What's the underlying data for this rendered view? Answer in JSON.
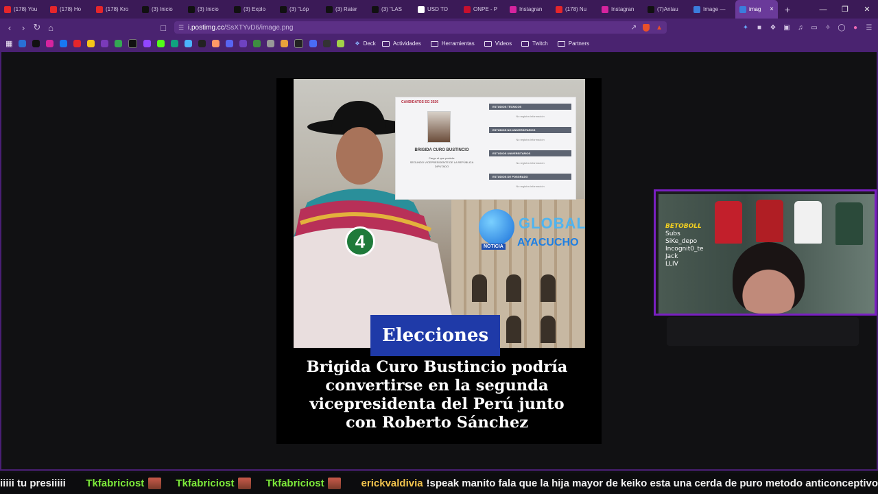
{
  "tabs": [
    {
      "label": "(178) You",
      "icon": "youtube-icon",
      "color": "#e5262b"
    },
    {
      "label": "(178) Ho",
      "icon": "youtube-icon",
      "color": "#e5262b"
    },
    {
      "label": "(178) Kro",
      "icon": "youtube-icon",
      "color": "#e5262b"
    },
    {
      "label": "(3) Inicio",
      "icon": "x-icon",
      "color": "#111111"
    },
    {
      "label": "(3) Inicio",
      "icon": "x-icon",
      "color": "#111111"
    },
    {
      "label": "(3) Explo",
      "icon": "x-icon",
      "color": "#111111"
    },
    {
      "label": "(3) \"Lóp",
      "icon": "x-icon",
      "color": "#111111"
    },
    {
      "label": "(3) Rater",
      "icon": "x-icon",
      "color": "#111111"
    },
    {
      "label": "(3) \"LAS",
      "icon": "x-icon",
      "color": "#111111"
    },
    {
      "label": "USD TO",
      "icon": "google-icon",
      "color": "#ffffff"
    },
    {
      "label": "ONPE - P",
      "icon": "onpe-icon",
      "color": "#c8102e"
    },
    {
      "label": "Instagran",
      "icon": "instagram-icon",
      "color": "#d6249f"
    },
    {
      "label": "(178) Nu",
      "icon": "youtube-icon",
      "color": "#e5262b"
    },
    {
      "label": "Instagran",
      "icon": "instagram-icon",
      "color": "#d6249f"
    },
    {
      "label": "(7)Antau",
      "icon": "tiktok-icon",
      "color": "#111111"
    },
    {
      "label": "Image —",
      "icon": "postimages-icon",
      "color": "#3b7ddd"
    },
    {
      "label": "imag",
      "icon": "postimages-icon",
      "color": "#3b7ddd",
      "active": true
    }
  ],
  "url": {
    "host": "i.postimg.cc",
    "path": "/SsXTYvD6/image.png"
  },
  "bookmarks": {
    "deck": "Deck",
    "folders": [
      "Actividades",
      "Herramientas",
      "Videos",
      "Twitch",
      "Partners"
    ]
  },
  "card": {
    "back": "CANDIDATOS EG 2026",
    "name": "BRIGIDA CURO BUSTINCIO",
    "cargo_label": "Cargo al que postula:",
    "cargo": "SEGUNDO VICEPRESIDENTE DE LA REPÚBLICA",
    "cargo2": "DIPUTADO",
    "sections": [
      "ESTUDIOS TÉCNICOS",
      "ESTUDIOS NO UNIVERSITARIOS",
      "ESTUDIOS UNIVERSITARIOS",
      "ESTUDIOS DE POSGRADO"
    ],
    "no_records": "No registra información"
  },
  "logo": {
    "global": "GLOBAL",
    "ayacucho": "AYACUCHO",
    "noticia": "NOTICIA"
  },
  "badge_number": "4",
  "section_tag": "Elecciones",
  "headline": "Brigida Curo Bustincio podría convertirse en la segunda vicepresidenta del Perú junto con Roberto Sánchez",
  "webcam": {
    "brand": "BETOBOLL",
    "lines": [
      "Subs",
      "SiKe_depo",
      "Incognit0_te",
      "Jack",
      "LLIV"
    ]
  },
  "ticker": {
    "partial": "iiiii tu presiiiii",
    "user1": "Tkfabriciost",
    "user2": "Tkfabriciost",
    "user3": "Tkfabriciost",
    "user4": "erickvaldivia",
    "message": "!speak manito fala que la hija mayor de keiko esta una cerda de puro metodo anticonceptivo"
  }
}
